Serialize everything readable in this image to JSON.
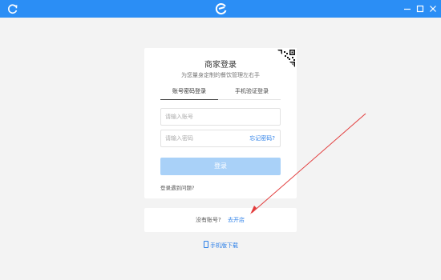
{
  "window": {
    "buttons": [
      "refresh",
      "minimize",
      "maximize",
      "close"
    ],
    "accent_color": "#2b8ef5"
  },
  "login": {
    "title": "商家登录",
    "subtitle": "为您量身定制的餐饮管理左右手",
    "tabs": [
      {
        "label": "账号密码登录",
        "active": true
      },
      {
        "label": "手机验证登录",
        "active": false
      }
    ],
    "account_placeholder": "请输入账号",
    "account_value": "",
    "password_placeholder": "请输入密码",
    "password_value": "",
    "forgot_label": "忘记密码?",
    "login_label": "登录",
    "trouble_label": "登录遇到问题?"
  },
  "signup": {
    "prompt": "没有账号?",
    "link": "去开店"
  },
  "mobile_download": "手机版下载",
  "colors": {
    "link": "#2b7fe8",
    "button_disabled": "#a9d1f8",
    "annotation_arrow": "#e23b3b"
  }
}
